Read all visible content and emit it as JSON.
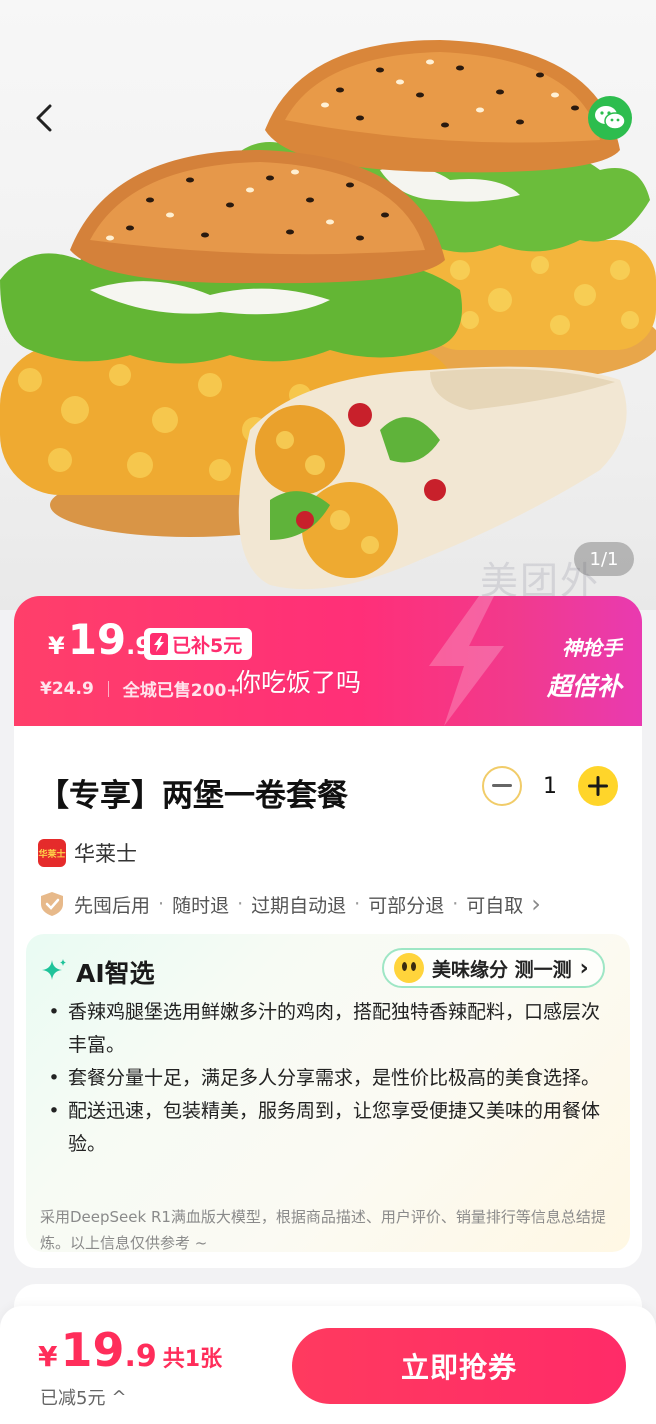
{
  "hero": {
    "image_label": "burger-combo-photo",
    "counter": "1/1",
    "watermark": "美团外"
  },
  "nav": {
    "back_icon": "chevron-left-icon",
    "share_icon": "wechat-icon"
  },
  "price_banner": {
    "currency": "¥",
    "price_int": "19",
    "price_dec": ".9",
    "subsidy_tag": "已补5元",
    "orig_price": "¥24.9",
    "sold": "全城已售200+",
    "badge_line1": "神抢手",
    "badge_line2": "超倍补",
    "overlay_text": "你吃饭了吗"
  },
  "product": {
    "title": "【专享】两堡一卷套餐",
    "quantity": "1",
    "brand_logo_text": "华莱士",
    "brand": "华莱士",
    "services": [
      "先囤后用",
      "随时退",
      "过期自动退",
      "可部分退",
      "可自取"
    ],
    "services_arrow": "›"
  },
  "ai": {
    "title": "AI智选",
    "taste_pill": "美味缘分 测一测",
    "taste_arrow": "›",
    "bullets": [
      "香辣鸡腿堡选用鲜嫩多汁的鸡肉，搭配独特香辣配料，口感层次丰富。",
      "套餐分量十足，满足多人分享需求，是性价比极高的美食选择。",
      "配送迅速，包装精美，服务周到，让您享受便捷又美味的用餐体验。"
    ],
    "note": "采用DeepSeek R1满血版大模型，根据商品描述、用户评价、销量排行等信息总结提炼。以上信息仅供参考 ~"
  },
  "bottom_bar": {
    "currency": "¥",
    "price_int": "19",
    "price_dec": ".9",
    "count": "共1张",
    "reduced": "已减5元",
    "reduced_arrow": "^",
    "cta": "立即抢券"
  },
  "colors": {
    "accent_pink": "#ff2d6f",
    "cta_red": "#ff3a5f",
    "plus_yellow": "#ffd52a",
    "wechat_green": "#2dbd4e"
  }
}
